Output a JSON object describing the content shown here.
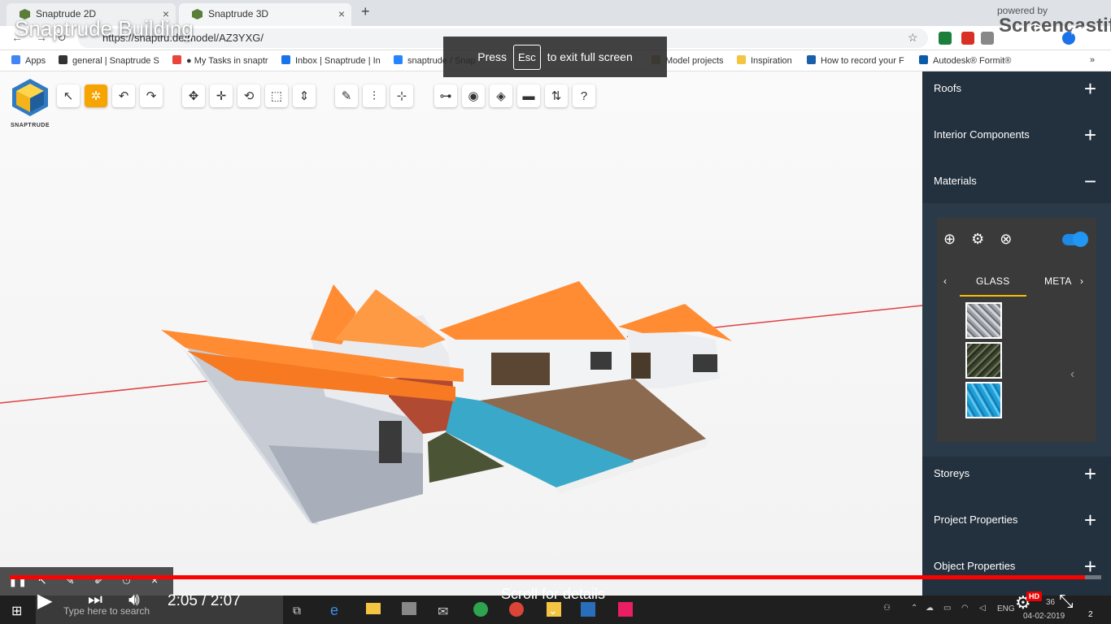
{
  "browser": {
    "tabs": [
      {
        "title": "Snaptrude 2D"
      },
      {
        "title": "Snaptrude 3D"
      }
    ],
    "url": "https://snaptru.de/model/AZ3YXG/",
    "bookmarks": [
      {
        "label": "Apps",
        "color": "#4285f4"
      },
      {
        "label": "general | Snaptrude S",
        "color": "#333333"
      },
      {
        "label": "● My Tasks in snaptr",
        "color": "#e8453c"
      },
      {
        "label": "Inbox | Snaptrude | In",
        "color": "#1a73e8"
      },
      {
        "label": "snaptrude / Snap",
        "color": "#2684ff"
      },
      {
        "label": "Model projects",
        "color": "#c8b37c"
      },
      {
        "label": "Inspiration",
        "color": "#f4c542"
      },
      {
        "label": "How to record your F",
        "color": "#1a5fa8"
      },
      {
        "label": "Autodesk® Formit®",
        "color": "#0a5ca8"
      }
    ],
    "bookmarks_more": "»"
  },
  "app": {
    "logo_text": "SNAPTRUDE",
    "toolbar": [
      {
        "icon": "pointer-icon",
        "glyph": "↖",
        "active": false
      },
      {
        "icon": "orbit-icon",
        "glyph": "✲",
        "active": true
      },
      {
        "icon": "undo-icon",
        "glyph": "↶",
        "active": false
      },
      {
        "icon": "redo-icon",
        "glyph": "↷",
        "active": false
      },
      {
        "icon": "move-icon",
        "glyph": "✥",
        "active": false
      },
      {
        "icon": "pan-icon",
        "glyph": "✛",
        "active": false
      },
      {
        "icon": "rotate-icon",
        "glyph": "⟲",
        "active": false
      },
      {
        "icon": "scale-icon",
        "glyph": "⬚",
        "active": false
      },
      {
        "icon": "push-pull-icon",
        "glyph": "⇕",
        "active": false
      },
      {
        "icon": "pencil-icon",
        "glyph": "✎",
        "active": false
      },
      {
        "icon": "split-icon",
        "glyph": "⫶",
        "active": false
      },
      {
        "icon": "align-icon",
        "glyph": "⊹",
        "active": false
      },
      {
        "icon": "tape-measure-icon",
        "glyph": "⊶",
        "active": false
      },
      {
        "icon": "eye-icon",
        "glyph": "◉",
        "active": false
      },
      {
        "icon": "layers-icon",
        "glyph": "◈",
        "active": false
      },
      {
        "icon": "display-icon",
        "glyph": "▬",
        "active": false
      },
      {
        "icon": "section-icon",
        "glyph": "⇅",
        "active": false
      },
      {
        "icon": "help-icon",
        "glyph": "?",
        "active": false
      }
    ],
    "panel": {
      "sections_top": [
        {
          "label": "Roofs",
          "sign": "+"
        },
        {
          "label": "Interior Components",
          "sign": "+"
        },
        {
          "label": "Materials",
          "sign": "−"
        }
      ],
      "materials": {
        "tabs": {
          "prev": "‹",
          "active": "GLASS",
          "next_partial": "META",
          "next": "›"
        },
        "collapse": "‹"
      },
      "sections_bottom": [
        {
          "label": "Storeys",
          "sign": "+"
        },
        {
          "label": "Project Properties",
          "sign": "+"
        },
        {
          "label": "Object Properties",
          "sign": "+"
        }
      ]
    }
  },
  "overlay": {
    "video_title": "Snaptrude Building",
    "powered_by": "powered by",
    "brand": "Screencastify",
    "esc_prefix": "Press",
    "esc_key": "Esc",
    "esc_suffix": "to exit full screen",
    "time_current": "2:05",
    "time_sep": "/",
    "time_total": "2:07",
    "progress": 0.985,
    "scroll_hint": "Scroll for details",
    "hd": "HD"
  },
  "taskbar": {
    "search_placeholder": "Type here to search",
    "lang": "ENG",
    "clock_time": "36",
    "clock_date": "04-02-2019",
    "notifications": "2"
  }
}
